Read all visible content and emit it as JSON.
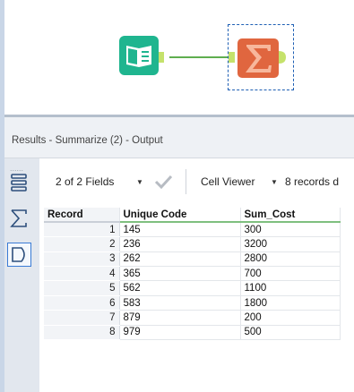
{
  "canvas": {
    "tools": [
      {
        "name": "Input Data",
        "icon": "book-icon",
        "color": "#1fb58f"
      },
      {
        "name": "Summarize",
        "icon": "sigma-icon",
        "color": "#e0663f"
      }
    ],
    "connector_color": "#5fae4f",
    "anchor_color": "#c5e26b"
  },
  "results": {
    "title": "Results - Summarize (2) - Output",
    "fields_label": "2 of 2 Fields",
    "viewer_label": "Cell Viewer",
    "records_label": "8 records d",
    "grip": "......"
  },
  "side_buttons": [
    {
      "icon": "metadata-icon"
    },
    {
      "icon": "sigma-icon"
    },
    {
      "icon": "output-anchor-icon",
      "selected": true
    }
  ],
  "grid": {
    "columns": [
      "Record",
      "Unique Code",
      "Sum_Cost"
    ],
    "rows": [
      [
        "1",
        "145",
        "300"
      ],
      [
        "2",
        "236",
        "3200"
      ],
      [
        "3",
        "262",
        "2800"
      ],
      [
        "4",
        "365",
        "700"
      ],
      [
        "5",
        "562",
        "1100"
      ],
      [
        "6",
        "583",
        "1800"
      ],
      [
        "7",
        "879",
        "200"
      ],
      [
        "8",
        "979",
        "500"
      ]
    ]
  }
}
